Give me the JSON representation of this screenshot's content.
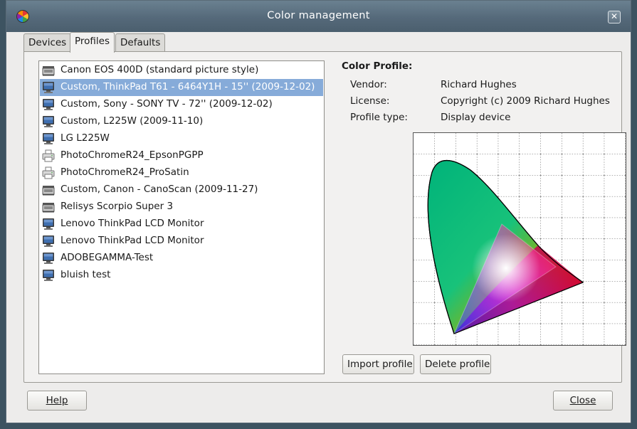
{
  "window": {
    "title": "Color management"
  },
  "tabs": [
    {
      "label": "Devices"
    },
    {
      "label": "Profiles"
    },
    {
      "label": "Defaults"
    }
  ],
  "profiles": [
    {
      "label": "Canon EOS 400D (standard picture style)",
      "icon": "scanner-icon"
    },
    {
      "label": "Custom, ThinkPad T61 - 6464Y1H - 15'' (2009-12-02)",
      "icon": "monitor-icon"
    },
    {
      "label": "Custom, Sony - SONY TV - 72'' (2009-12-02)",
      "icon": "monitor-icon"
    },
    {
      "label": "Custom, L225W (2009-11-10)",
      "icon": "monitor-icon"
    },
    {
      "label": "LG L225W",
      "icon": "monitor-icon"
    },
    {
      "label": "PhotoChromeR24_EpsonPGPP",
      "icon": "printer-icon"
    },
    {
      "label": "PhotoChromeR24_ProSatin",
      "icon": "printer-icon"
    },
    {
      "label": "Custom, Canon - CanoScan (2009-11-27)",
      "icon": "scanner-icon"
    },
    {
      "label": "Relisys Scorpio Super 3",
      "icon": "scanner-icon"
    },
    {
      "label": "Lenovo ThinkPad LCD Monitor",
      "icon": "monitor-icon"
    },
    {
      "label": "Lenovo ThinkPad LCD Monitor",
      "icon": "monitor-icon"
    },
    {
      "label": "ADOBEGAMMA-Test",
      "icon": "monitor-icon"
    },
    {
      "label": "bluish test",
      "icon": "monitor-icon"
    }
  ],
  "selected_profile_index": 1,
  "details": {
    "heading": "Color Profile:",
    "vendor_label": "Vendor:",
    "vendor_value": "Richard Hughes",
    "license_label": "License:",
    "license_value": "Copyright (c) 2009 Richard Hughes",
    "type_label": "Profile type:",
    "type_value": "Display device"
  },
  "buttons": {
    "import": "Import profile",
    "delete": "Delete profile",
    "help": "Help",
    "close": "Close"
  },
  "colors": {
    "selection": "#86abd9",
    "titlebar": "#55697a",
    "desktop": "#3d5361"
  }
}
